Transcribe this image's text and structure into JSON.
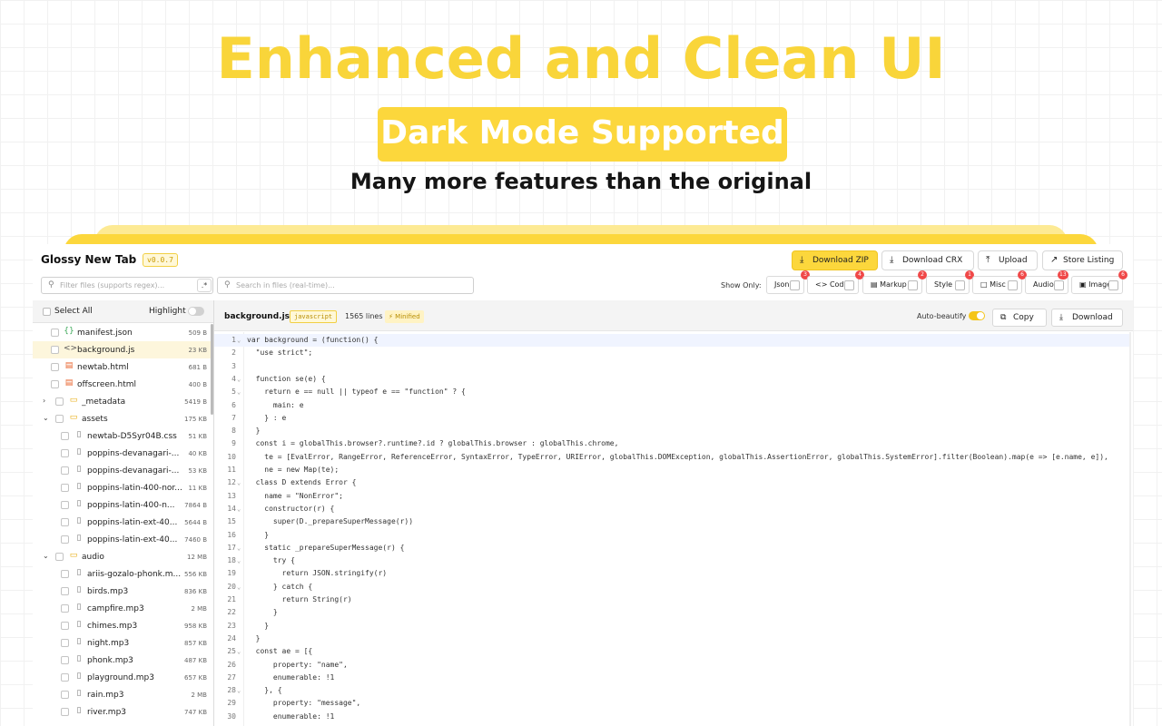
{
  "hero": {
    "title": "Enhanced and Clean UI",
    "badge": "Dark Mode Supported",
    "subtitle": "Many more features than the original"
  },
  "app": {
    "name": "Glossy New Tab",
    "version": "v0.0.7",
    "buttons": {
      "download_zip": "Download ZIP",
      "download_crx": "Download CRX",
      "upload": "Upload",
      "store_listing": "Store Listing"
    },
    "filter_placeholder": "Filter files (supports regex)...",
    "regex_label": ".*",
    "search_placeholder": "Search in files (real-time)...",
    "show_only_label": "Show Only:",
    "filters": [
      {
        "label": "Json",
        "icon": "",
        "count": "3"
      },
      {
        "label": "Code",
        "icon": "<>",
        "count": "4"
      },
      {
        "label": "Markup",
        "icon": "▤",
        "count": "2"
      },
      {
        "label": "Style",
        "icon": "",
        "count": "1"
      },
      {
        "label": "Misc",
        "icon": "□",
        "count": "6"
      },
      {
        "label": "Audio",
        "icon": "",
        "count": "13"
      },
      {
        "label": "Image",
        "icon": "▣",
        "count": "6"
      }
    ]
  },
  "sidebar": {
    "select_all": "Select All",
    "highlight": "Highlight",
    "files": [
      {
        "name": "manifest.json",
        "size": "509 B",
        "icon": "{}",
        "color": "#3aa757",
        "indent": 1
      },
      {
        "name": "background.js",
        "size": "23 KB",
        "icon": "<>",
        "color": "#555555",
        "indent": 1,
        "selected": true
      },
      {
        "name": "newtab.html",
        "size": "681 B",
        "icon": "▤",
        "color": "#e8622a",
        "indent": 1
      },
      {
        "name": "offscreen.html",
        "size": "400 B",
        "icon": "▤",
        "color": "#e8622a",
        "indent": 1
      },
      {
        "name": "_metadata",
        "size": "5419 B",
        "icon": "▭",
        "color": "#e6a700",
        "indent": 0,
        "folder": "closed"
      },
      {
        "name": "assets",
        "size": "175 KB",
        "icon": "▭",
        "color": "#e6a700",
        "indent": 0,
        "folder": "open"
      },
      {
        "name": "newtab-D5Syr04B.css",
        "size": "51 KB",
        "icon": "▯",
        "color": "#777777",
        "indent": 2
      },
      {
        "name": "poppins-devanagari-...",
        "size": "40 KB",
        "icon": "▯",
        "color": "#777777",
        "indent": 2
      },
      {
        "name": "poppins-devanagari-...",
        "size": "53 KB",
        "icon": "▯",
        "color": "#777777",
        "indent": 2
      },
      {
        "name": "poppins-latin-400-nor...",
        "size": "11 KB",
        "icon": "▯",
        "color": "#777777",
        "indent": 2
      },
      {
        "name": "poppins-latin-400-n...",
        "size": "7864 B",
        "icon": "▯",
        "color": "#777777",
        "indent": 2
      },
      {
        "name": "poppins-latin-ext-40...",
        "size": "5644 B",
        "icon": "▯",
        "color": "#777777",
        "indent": 2
      },
      {
        "name": "poppins-latin-ext-40...",
        "size": "7460 B",
        "icon": "▯",
        "color": "#777777",
        "indent": 2
      },
      {
        "name": "audio",
        "size": "12 MB",
        "icon": "▭",
        "color": "#e6a700",
        "indent": 0,
        "folder": "open"
      },
      {
        "name": "ariis-gozalo-phonk.m...",
        "size": "556 KB",
        "icon": "▯",
        "color": "#777777",
        "indent": 2
      },
      {
        "name": "birds.mp3",
        "size": "836 KB",
        "icon": "▯",
        "color": "#777777",
        "indent": 2
      },
      {
        "name": "campfire.mp3",
        "size": "2 MB",
        "icon": "▯",
        "color": "#777777",
        "indent": 2
      },
      {
        "name": "chimes.mp3",
        "size": "958 KB",
        "icon": "▯",
        "color": "#777777",
        "indent": 2
      },
      {
        "name": "night.mp3",
        "size": "857 KB",
        "icon": "▯",
        "color": "#777777",
        "indent": 2
      },
      {
        "name": "phonk.mp3",
        "size": "487 KB",
        "icon": "▯",
        "color": "#777777",
        "indent": 2
      },
      {
        "name": "playground.mp3",
        "size": "657 KB",
        "icon": "▯",
        "color": "#777777",
        "indent": 2
      },
      {
        "name": "rain.mp3",
        "size": "2 MB",
        "icon": "▯",
        "color": "#777777",
        "indent": 2
      },
      {
        "name": "river.mp3",
        "size": "747 KB",
        "icon": "▯",
        "color": "#777777",
        "indent": 2
      }
    ]
  },
  "editor": {
    "filename": "background.js",
    "language": "javascript",
    "lines_count": "1565 lines",
    "minified": "Minified",
    "auto_beautify": "Auto-beautify",
    "copy": "Copy",
    "download": "Download",
    "lines": [
      {
        "n": "1",
        "t": "var background = (function() {",
        "fold": true
      },
      {
        "n": "2",
        "t": "  \"use strict\";"
      },
      {
        "n": "3",
        "t": ""
      },
      {
        "n": "4",
        "t": "  function se(e) {",
        "fold": true
      },
      {
        "n": "5",
        "t": "    return e == null || typeof e == \"function\" ? {",
        "fold": true
      },
      {
        "n": "6",
        "t": "      main: e"
      },
      {
        "n": "7",
        "t": "    } : e"
      },
      {
        "n": "8",
        "t": "  }"
      },
      {
        "n": "9",
        "t": "  const i = globalThis.browser?.runtime?.id ? globalThis.browser : globalThis.chrome,"
      },
      {
        "n": "10",
        "t": "    te = [EvalError, RangeError, ReferenceError, SyntaxError, TypeError, URIError, globalThis.DOMException, globalThis.AssertionError, globalThis.SystemError].filter(Boolean).map(e => [e.name, e]),"
      },
      {
        "n": "11",
        "t": "    ne = new Map(te);"
      },
      {
        "n": "12",
        "t": "  class D extends Error {",
        "fold": true
      },
      {
        "n": "13",
        "t": "    name = \"NonError\";"
      },
      {
        "n": "14",
        "t": "    constructor(r) {",
        "fold": true
      },
      {
        "n": "15",
        "t": "      super(D._prepareSuperMessage(r))"
      },
      {
        "n": "16",
        "t": "    }"
      },
      {
        "n": "17",
        "t": "    static _prepareSuperMessage(r) {",
        "fold": true
      },
      {
        "n": "18",
        "t": "      try {",
        "fold": true
      },
      {
        "n": "19",
        "t": "        return JSON.stringify(r)"
      },
      {
        "n": "20",
        "t": "      } catch {",
        "fold": true
      },
      {
        "n": "21",
        "t": "        return String(r)"
      },
      {
        "n": "22",
        "t": "      }"
      },
      {
        "n": "23",
        "t": "    }"
      },
      {
        "n": "24",
        "t": "  }"
      },
      {
        "n": "25",
        "t": "  const ae = [{",
        "fold": true
      },
      {
        "n": "26",
        "t": "      property: \"name\","
      },
      {
        "n": "27",
        "t": "      enumerable: !1"
      },
      {
        "n": "28",
        "t": "    }, {",
        "fold": true
      },
      {
        "n": "29",
        "t": "      property: \"message\","
      },
      {
        "n": "30",
        "t": "      enumerable: !1"
      }
    ]
  }
}
